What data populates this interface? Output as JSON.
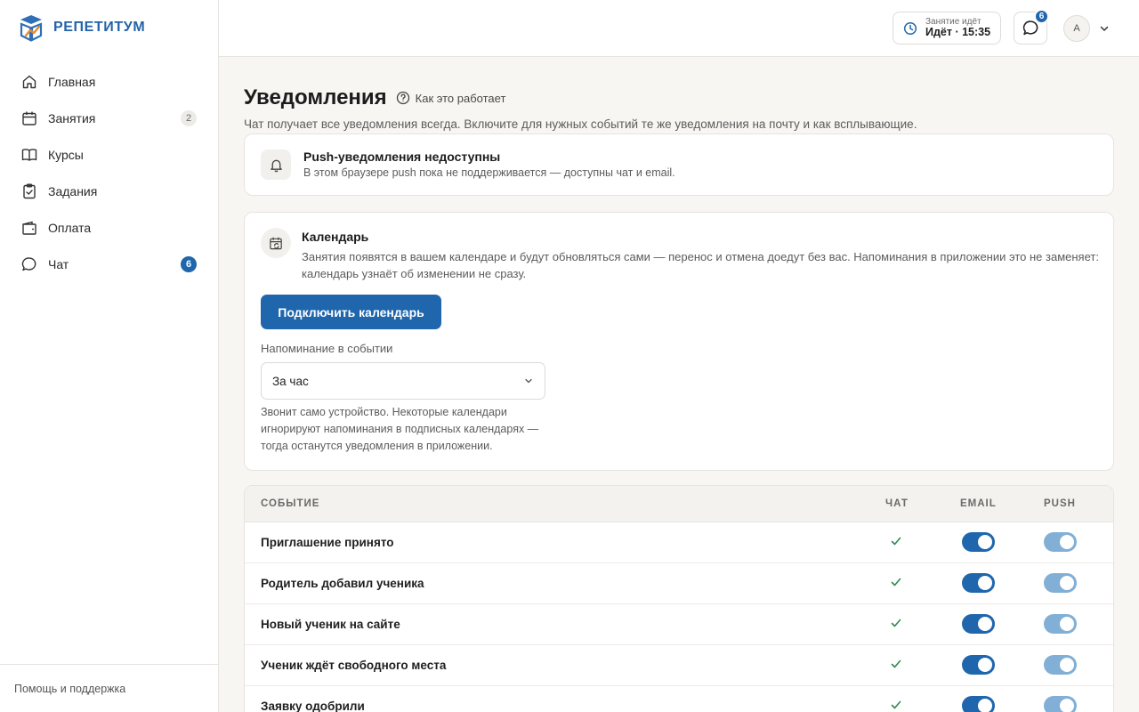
{
  "brand": {
    "name": "РЕПЕТИТУМ",
    "accent": "#1f66ad"
  },
  "sidebar": {
    "items": [
      {
        "label": "Главная",
        "icon": "home-icon",
        "badge": ""
      },
      {
        "label": "Занятия",
        "icon": "calendar-icon",
        "badge": "2"
      },
      {
        "label": "Курсы",
        "icon": "book-icon",
        "badge": ""
      },
      {
        "label": "Задания",
        "icon": "clipboard-check-icon",
        "badge": ""
      },
      {
        "label": "Оплата",
        "icon": "wallet-icon",
        "badge": ""
      },
      {
        "label": "Чат",
        "icon": "chat-icon",
        "badge": "6"
      }
    ],
    "footer": "Помощь и поддержка"
  },
  "topbar": {
    "lesson_label": "Занятие идёт",
    "lesson_value": "Идёт · 15:35",
    "chat_badge": "6",
    "avatar_initial": "A"
  },
  "page": {
    "title": "Уведомления",
    "howto": "Как это работает",
    "subtitle": "Чат получает все уведомления всегда. Включите для нужных событий те же уведомления на почту и как всплывающие."
  },
  "push_card": {
    "title": "Push-уведомления недоступны",
    "subtitle": "В этом браузере push пока не поддерживается — доступны чат и email."
  },
  "calendar_card": {
    "title": "Календарь",
    "description": "Занятия появятся в вашем календаре и будут обновляться сами — перенос и отмена доедут без вас. Напоминания в приложении это не заменяет: календарь узнаёт об изменении не сразу.",
    "button": "Подключить календарь",
    "reminder_label": "Напоминание в событии",
    "reminder_value": "За час",
    "hint": "Звонит само устройство. Некоторые календари игнорируют напоминания в подписных календарях — тогда останутся уведомления в приложении."
  },
  "table": {
    "headers": {
      "event": "СОБЫТИЕ",
      "chat": "ЧАТ",
      "email": "EMAIL",
      "push": "PUSH"
    },
    "rows": [
      {
        "event": "Приглашение принято",
        "chat": true,
        "email": true,
        "push": true
      },
      {
        "event": "Родитель добавил ученика",
        "chat": true,
        "email": true,
        "push": true
      },
      {
        "event": "Новый ученик на сайте",
        "chat": true,
        "email": true,
        "push": true
      },
      {
        "event": "Ученик ждёт свободного места",
        "chat": true,
        "email": true,
        "push": true
      },
      {
        "event": "Заявку одобрили",
        "chat": true,
        "email": true,
        "push": true
      }
    ]
  }
}
